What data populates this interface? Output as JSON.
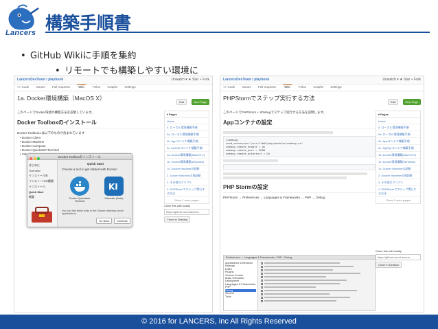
{
  "slide": {
    "title": "構築手順書",
    "logo_text": "Lancers",
    "bullets": [
      "GitHub Wikiに手順を集約",
      "リモートでも構築しやすい環境に"
    ],
    "bullet_mark": "•",
    "footer": "© 2016 for LANCERS, inc All Rights Reserved"
  },
  "colors": {
    "brand": "#1a4f9c",
    "gh_link": "#4078c0",
    "gh_green": "#55a532"
  },
  "left": {
    "repo": "LancersDevTeam / playbook",
    "repo_actions": "Unwatch ▾  ★ Star  ⑂ Fork",
    "tabs": [
      "<> Code",
      "Issues",
      "Pull requests",
      "Wiki",
      "Pulse",
      "Graphs",
      "Settings"
    ],
    "active_tab": "Wiki",
    "page_title": "1a. Docker環境構築（MacOS X）",
    "edit_label": "Edit",
    "new_page_label": "New Page",
    "lead": "このページでDocker環境の構築方法を説明しています。",
    "heading": "Docker Toolboxのインストール",
    "list_intro": "Docker Toolboxには以下のものが含まれています",
    "list": [
      "Docker Client",
      "Docker Machine",
      "Docker Compose",
      "Docker Quickstart Terminal",
      "VirtualBox"
    ],
    "sidebar_head": "▾ Pages",
    "sidebar_items": [
      "Home",
      "0. ローカル環境構築手順",
      "0a. ローカル環境構築手順",
      "0b. Appコンテナ構築手順",
      "0c. MySQLコンテナ構築手順",
      "1a. Docker環境構築(MacOS X)",
      "1b. Docker環境構築(Windows)",
      "1c. Docker Machineの起動",
      "2. Docker Machineの再起動",
      "3. その他スクリプト",
      "4. PHPStormでステップ実行する方法"
    ],
    "sidebar_more": "Show 1 more pages",
    "clone_label": "Clone this wiki locally",
    "clone_url": "https://github.com/Lancers...",
    "clone_desktop": "Clone in Desktop",
    "dialog": {
      "title": "Docker Toolboxのインストール",
      "side": [
        "はじめに",
        "Overview",
        "インストール先",
        "インストールの種類",
        "インストール",
        "Quick Start",
        "概要"
      ],
      "selected": "Quick Start",
      "quick_start": "Quick Start",
      "choose": "Choose a tool to get started with Docker:",
      "app1": "Docker Quickstart Terminal",
      "app2": "Kitematic (Beta)",
      "note": "You can find these tools in the Docker directory under Applications.",
      "back": "Go Back",
      "continue": "Continue"
    }
  },
  "right": {
    "repo": "LancersDevTeam / playbook",
    "repo_actions": "Unwatch ▾  ★ Star  ⑂ Fork",
    "tabs": [
      "<> Code",
      "Issues",
      "Pull requests",
      "Wiki",
      "Pulse",
      "Graphs",
      "Settings"
    ],
    "active_tab": "Wiki",
    "page_title": "PHPStormでステップ実行する方法",
    "edit_label": "Edit",
    "new_page_label": "New Page",
    "lead": "このページでPHPStorm + XDebugでステップ実行する方法を説明します。",
    "heading1": "Appコンテナの設定",
    "code1": "[xdebug]\nzend_extension=\"/usr/lib64/php/modules/xdebug.so\"\nxdebug.remote_enable = On\nxdebug.remote_port = 9000\nxdebug.remote_autostart = On",
    "heading2": "PHP Stormの設定",
    "breadcrumb": "PHPStorm → Preferences → Languages & Frameworks → PHP → Debug",
    "sidebar_head": "▾ Pages",
    "sidebar_items": [
      "Home",
      "0. ローカル環境構築手順",
      "0a. ローカル環境構築手順",
      "0b. Appコンテナ構築手順",
      "0c. MySQLコンテナ構築手順",
      "1a. Docker環境構築(MacOS X)",
      "1b. Docker環境構築(Windows)",
      "1c. Docker Machineの起動",
      "2. Docker Machineの再起動",
      "3. その他スクリプト",
      "4. PHPStormでステップ実行する方法"
    ],
    "sidebar_more": "Show 1 more pages",
    "clone_label": "Clone this wiki locally",
    "clone_url": "https://github.com/Lancers...",
    "clone_desktop": "Clone in Desktop",
    "settings_title": "Preferences",
    "settings_path": "Languages & Frameworks › PHP › Debug",
    "settings_tree": [
      "Appearance & Behavior",
      "Keymap",
      "Editor",
      "Plugins",
      "Version Control",
      "Build, Execution, Deployment",
      "Languages & Frameworks",
      "PHP",
      "Debug",
      "Servers",
      "Tools"
    ],
    "settings_selected": "Debug"
  }
}
